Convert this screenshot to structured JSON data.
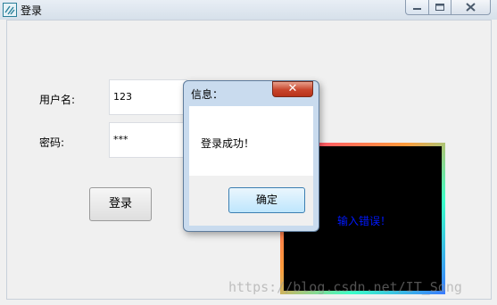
{
  "window": {
    "title": "登录"
  },
  "form": {
    "username_label": "用户名:",
    "username_value": "123",
    "password_label": "密码:",
    "password_value": "***",
    "login_button": "登录"
  },
  "error_panel": {
    "text": "输入错误！",
    "text_color": "#0018ff"
  },
  "dialog": {
    "title": "信息：",
    "message": "登录成功！",
    "ok_button": "确定",
    "close_glyph": "✕"
  },
  "watermark": "https://blog.csdn.net/IT_Song"
}
